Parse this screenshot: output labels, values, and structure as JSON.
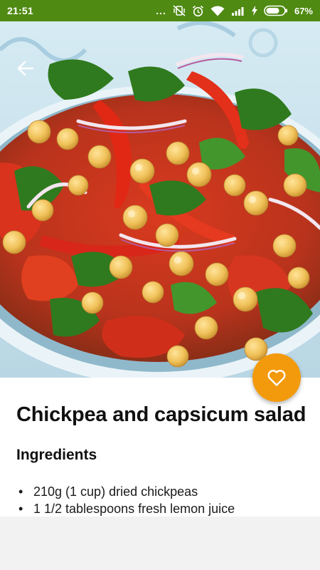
{
  "status_bar": {
    "time": "21:51",
    "overflow_dots": "...",
    "battery_percent": "67%",
    "background_color": "#4f8a12"
  },
  "hero": {
    "image_subject": "chickpea and capsicum salad in a bowl"
  },
  "recipe": {
    "title": "Chickpea and capsicum salad",
    "ingredients_heading": "Ingredients",
    "ingredients": [
      "210g (1 cup) dried chickpeas",
      "1 1/2 tablespoons fresh lemon juice"
    ]
  },
  "favorite": {
    "icon": "heart-outline-icon",
    "color": "#f39a0c"
  },
  "navigation": {
    "back_icon": "arrow-left-icon"
  }
}
